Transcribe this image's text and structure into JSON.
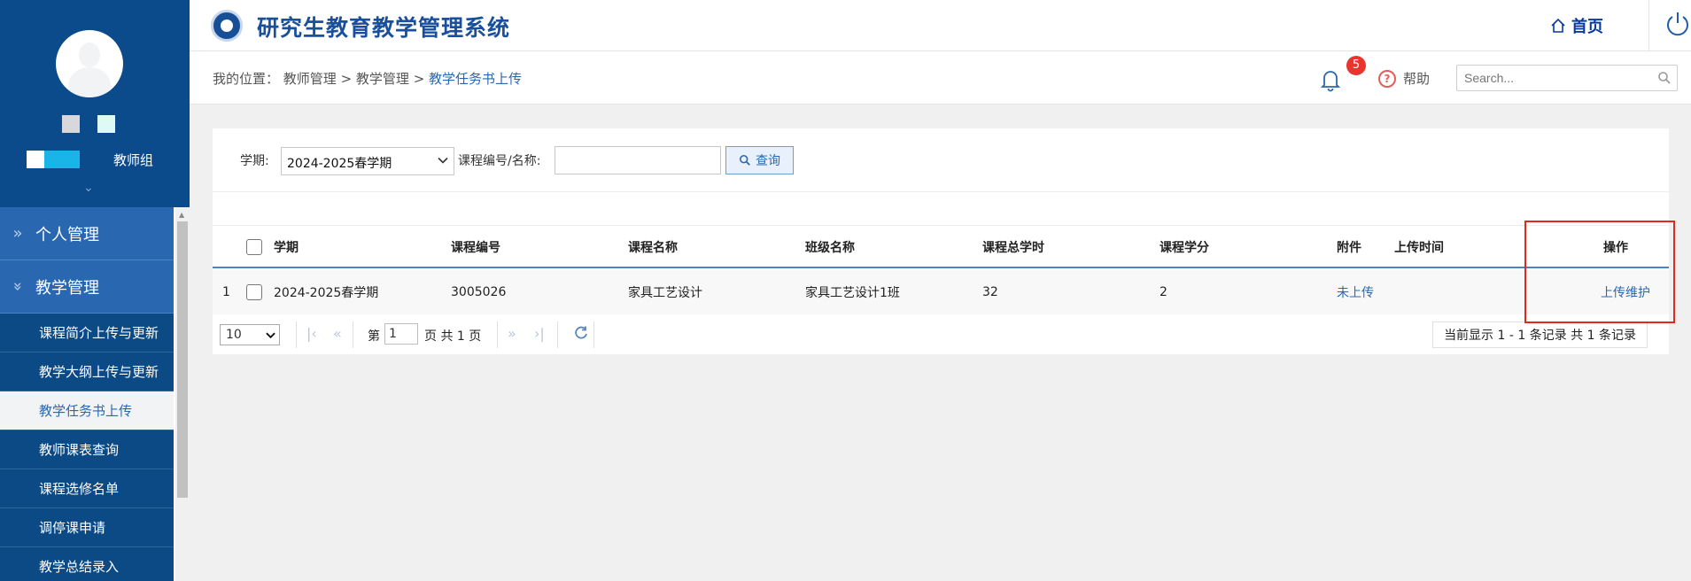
{
  "sidebar": {
    "role": "教师组",
    "groups": [
      {
        "label": "个人管理"
      },
      {
        "label": "教学管理"
      }
    ],
    "items": [
      {
        "label": "课程简介上传与更新"
      },
      {
        "label": "教学大纲上传与更新"
      },
      {
        "label": "教学任务书上传"
      },
      {
        "label": "教师课表查询"
      },
      {
        "label": "课程选修名单"
      },
      {
        "label": "调停课申请"
      },
      {
        "label": "教学总结录入"
      }
    ]
  },
  "header": {
    "title": "研究生教育教学管理系统",
    "home_label": "首页"
  },
  "breadcrumb": {
    "prefix": "我的位置：",
    "path": [
      "教师管理",
      "教学管理"
    ],
    "separator": " > ",
    "current": "教学任务书上传"
  },
  "notifications": {
    "count": "5"
  },
  "help_label": "帮助",
  "search": {
    "placeholder": "Search..."
  },
  "filter": {
    "term_label": "学期:",
    "term_value": "2024-2025春学期",
    "course_label": "课程编号/名称:",
    "query_label": "查询"
  },
  "table": {
    "columns": [
      "学期",
      "课程编号",
      "课程名称",
      "班级名称",
      "课程总学时",
      "课程学分",
      "附件",
      "上传时间",
      "操作"
    ],
    "rows": [
      {
        "index": "1",
        "term": "2024-2025春学期",
        "course_no": "3005026",
        "course_name": "家具工艺设计",
        "class_name": "家具工艺设计1班",
        "hours": "32",
        "credits": "2",
        "attachment": "未上传",
        "upload_time": "",
        "action": "上传维护"
      }
    ]
  },
  "pager": {
    "page_size": "10",
    "page_prefix": "第",
    "page": "1",
    "page_suffix": "页 共 1 页",
    "records": "当前显示 1 - 1 条记录 共 1 条记录"
  },
  "colors": {
    "sidebar_dark": "#0b4a8b",
    "sidebar_group": "#2a67b1",
    "accent": "#2a67b1",
    "highlight_box": "#e2271d",
    "badge": "#e8362f"
  }
}
